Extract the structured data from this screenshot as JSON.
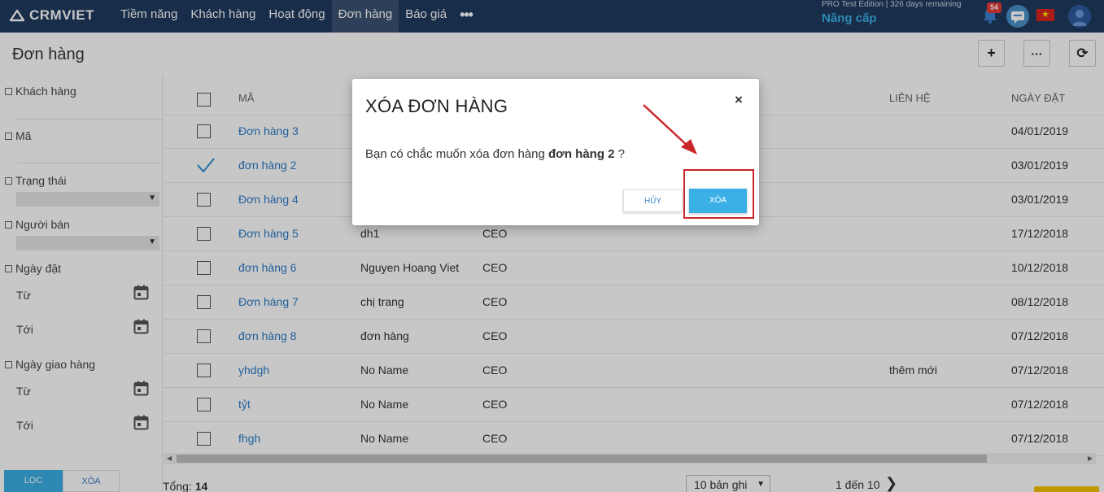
{
  "app": {
    "logo_text": "CRMVIET",
    "nav": [
      "Tiềm năng",
      "Khách hàng",
      "Hoạt động",
      "Đơn hàng",
      "Báo giá"
    ],
    "nav_active_index": 3,
    "nav_more": "•••",
    "edition": "PRO Test Edition | 326 days remaining",
    "upgrade_label": "Nâng cấp",
    "notification_count": "54",
    "flag_star": "★"
  },
  "page": {
    "title": "Đơn hàng",
    "toolbar": {
      "add": "+",
      "more": "···",
      "refresh": "⟳"
    }
  },
  "filters": {
    "customer": "Khách hàng",
    "code": "Mã",
    "status": "Trạng thái",
    "seller": "Người bán",
    "order_date": "Ngày đặt",
    "delivery_date": "Ngày giao hàng",
    "from": "Từ",
    "to": "Tới",
    "filter_button": "LỌC",
    "clear_button": "XÓA",
    "select_arrow": "▼"
  },
  "table": {
    "headers": {
      "code": "MÃ",
      "contact": "LIÊN HỆ",
      "date": "NGÀY ĐẶT"
    },
    "rows": [
      {
        "code": "Đơn hàng 3",
        "customer": "",
        "title": "",
        "contact": "",
        "date": "04/01/2019",
        "checked": false
      },
      {
        "code": "đơn hàng 2",
        "customer": "",
        "title": "",
        "contact": "",
        "date": "03/01/2019",
        "checked": true
      },
      {
        "code": "Đơn hàng 4",
        "customer": "",
        "title": "",
        "contact": "",
        "date": "03/01/2019",
        "checked": false
      },
      {
        "code": "Đơn hàng 5",
        "customer": "dh1",
        "title": "CEO",
        "contact": "",
        "date": "17/12/2018",
        "checked": false
      },
      {
        "code": "đơn hàng 6",
        "customer": "Nguyen Hoang Viet",
        "title": "CEO",
        "contact": "",
        "date": "10/12/2018",
        "checked": false
      },
      {
        "code": "Đơn hàng 7",
        "customer": "chị trang",
        "title": "CEO",
        "contact": "",
        "date": "08/12/2018",
        "checked": false
      },
      {
        "code": "đơn hàng 8",
        "customer": "đơn hàng",
        "title": "CEO",
        "contact": "",
        "date": "07/12/2018",
        "checked": false
      },
      {
        "code": "yhdgh",
        "customer": "No Name",
        "title": "CEO",
        "contact": "thêm mới",
        "date": "07/12/2018",
        "checked": false
      },
      {
        "code": "tỷt",
        "customer": "No Name",
        "title": "CEO",
        "contact": "",
        "date": "07/12/2018",
        "checked": false
      },
      {
        "code": "fhgh",
        "customer": "No Name",
        "title": "CEO",
        "contact": "",
        "date": "07/12/2018",
        "checked": false
      }
    ]
  },
  "footer": {
    "total_label": "Tổng:",
    "total_value": "14",
    "page_size": "10 bản ghi",
    "page_info": "1 đến 10",
    "next": "❯"
  },
  "modal": {
    "title": "XÓA ĐƠN HÀNG",
    "close": "×",
    "message_prefix": "Bạn có chắc muốn xóa đơn hàng",
    "message_target": "đơn hàng 2",
    "message_suffix": "?",
    "cancel_button": "HỦY",
    "confirm_button": "XÓA"
  },
  "colors": {
    "nav_bg": "#1f3a5f",
    "accent": "#3ab0e6",
    "link": "#2b7bc8",
    "annotation": "#c9262a"
  }
}
